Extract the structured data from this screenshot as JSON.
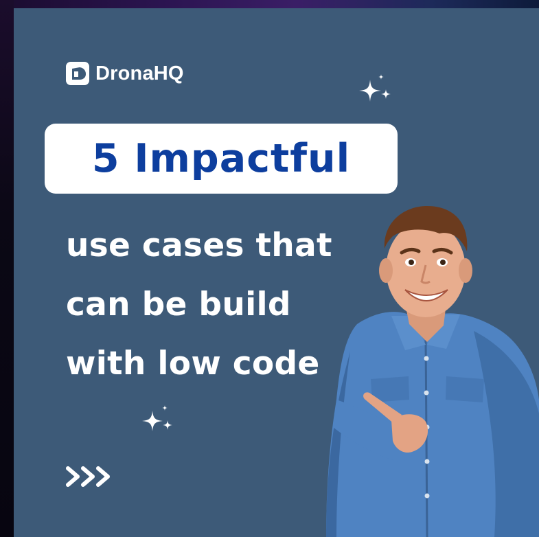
{
  "brand": {
    "name": "DronaHQ",
    "icon": "dronahq-logo-icon"
  },
  "headline": "5 Impactful",
  "subtitle_lines": [
    "use cases that",
    "can be build",
    "with low code"
  ],
  "decorations": {
    "sparkle_icon": "sparkle-icon",
    "chevrons_icon": "triple-chevron-right-icon"
  },
  "colors": {
    "background": "#3d5a78",
    "headline_text": "#0d3e9e",
    "headline_box": "#ffffff",
    "text": "#ffffff"
  }
}
